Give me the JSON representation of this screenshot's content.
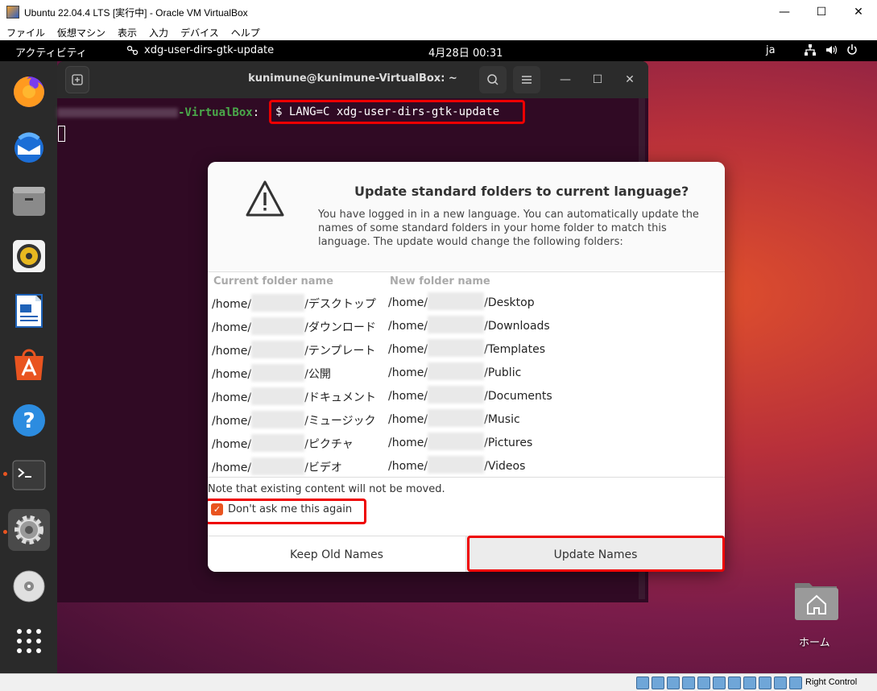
{
  "host": {
    "title": "Ubuntu 22.04.4 LTS [実行中] - Oracle VM VirtualBox",
    "controls": {
      "minimize": "—",
      "maximize": "☐",
      "close": "✕"
    },
    "menu": [
      "ファイル",
      "仮想マシン",
      "表示",
      "入力",
      "デバイス",
      "ヘルプ"
    ],
    "status": {
      "host_key": "Right Control"
    }
  },
  "topbar": {
    "activities": "アクティビティ",
    "app": "xdg-user-dirs-gtk-update",
    "clock": "4月28日  00:31",
    "lang": "ja"
  },
  "dock": {
    "items": [
      "firefox-icon",
      "thunderbird-icon",
      "files-icon",
      "rhythmbox-icon",
      "writer-icon",
      "software-icon",
      "help-icon",
      "terminal-icon",
      "settings-icon",
      "dvd-icon",
      "app-grid-icon"
    ]
  },
  "terminal": {
    "title": "kunimune@kunimune-VirtualBox: ~",
    "prompt_host": "-VirtualBox",
    "prompt_sep": ":",
    "command": "$ LANG=C xdg-user-dirs-gtk-update"
  },
  "dialog": {
    "heading": "Update standard folders to current language?",
    "body": "You have logged in in a new language. You can automatically update the names of some standard folders in your home folder to match this language. The update would change the following folders:",
    "col_current": "Current folder name",
    "col_new": "New folder name",
    "rows": [
      {
        "prefix": "/home/",
        "old": "/デスクトップ",
        "new": "/Desktop"
      },
      {
        "prefix": "/home/",
        "old": "/ダウンロード",
        "new": "/Downloads"
      },
      {
        "prefix": "/home/",
        "old": "/テンプレート",
        "new": "/Templates"
      },
      {
        "prefix": "/home/",
        "old": "/公開",
        "new": "/Public"
      },
      {
        "prefix": "/home/",
        "old": "/ドキュメント",
        "new": "/Documents"
      },
      {
        "prefix": "/home/",
        "old": "/ミュージック",
        "new": "/Music"
      },
      {
        "prefix": "/home/",
        "old": "/ピクチャ",
        "new": "/Pictures"
      },
      {
        "prefix": "/home/",
        "old": "/ビデオ",
        "new": "/Videos"
      }
    ],
    "note": "Note that existing content will not be moved.",
    "checkbox_label": "Don't ask me this again",
    "checkbox_checked": true,
    "btn_keep": "Keep Old Names",
    "btn_update": "Update Names"
  },
  "desktop": {
    "home_label": "ホーム"
  }
}
